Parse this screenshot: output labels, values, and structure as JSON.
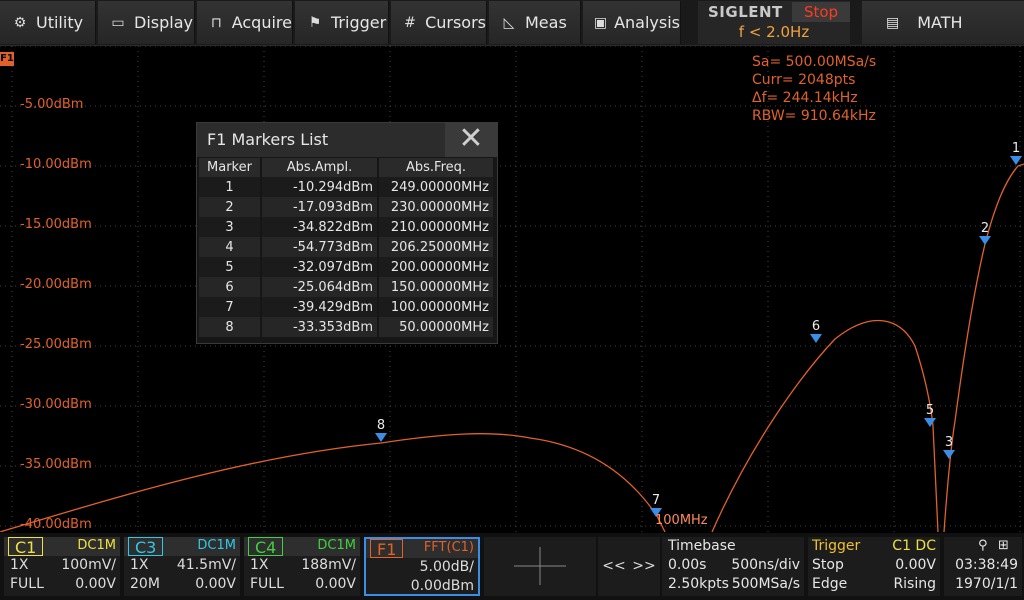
{
  "menu": {
    "utility": "Utility",
    "display": "Display",
    "acquire": "Acquire",
    "trigger": "Trigger",
    "cursors": "Cursors",
    "meas": "Meas",
    "analysis": "Analysis",
    "math": "MATH"
  },
  "brand": {
    "logo": "SIGLENT",
    "run_state": "Stop",
    "trigger_freq": "f < 2.0Hz"
  },
  "waveform": {
    "trace_tag": "F1",
    "y_labels": [
      "-5.00dBm",
      "-10.00dBm",
      "-15.00dBm",
      "-20.00dBm",
      "-25.00dBm",
      "-30.00dBm",
      "-35.00dBm",
      "-40.00dBm"
    ],
    "fft_info": {
      "sa": "Sa=  500.00MSa/s",
      "curr": "Curr= 2048pts",
      "df": "Δf=  244.14kHz",
      "rbw": "RBW=  910.64kHz"
    },
    "marker_freq_label": "100MHz",
    "marker_ids": [
      "1",
      "2",
      "3",
      "4",
      "5",
      "6",
      "7",
      "8"
    ],
    "trace_color": "#e0622a",
    "marker_color": "#3a8ee6"
  },
  "markers_list": {
    "title": "F1 Markers List",
    "columns": [
      "Marker",
      "Abs.Ampl.",
      "Abs.Freq."
    ],
    "rows": [
      [
        "1",
        "-10.294dBm",
        "249.00000MHz"
      ],
      [
        "2",
        "-17.093dBm",
        "230.00000MHz"
      ],
      [
        "3",
        "-34.822dBm",
        "210.00000MHz"
      ],
      [
        "4",
        "-54.773dBm",
        "206.25000MHz"
      ],
      [
        "5",
        "-32.097dBm",
        "200.00000MHz"
      ],
      [
        "6",
        "-25.064dBm",
        "150.00000MHz"
      ],
      [
        "7",
        "-39.429dBm",
        "100.00000MHz"
      ],
      [
        "8",
        "-33.353dBm",
        "50.00000MHz"
      ]
    ]
  },
  "channels": {
    "c1": {
      "name": "C1",
      "coupling": "DC1M",
      "probe": "1X",
      "scale": "100mV/",
      "bw": "FULL",
      "offset": "0.00V",
      "color": "#f0e040"
    },
    "c3": {
      "name": "C3",
      "coupling": "DC1M",
      "probe": "1X",
      "scale": "41.5mV/",
      "bw": "20M",
      "offset": "0.00V",
      "color": "#30c8e8"
    },
    "c4": {
      "name": "C4",
      "coupling": "DC1M",
      "probe": "1X",
      "scale": "188mV/",
      "bw": "FULL",
      "offset": "0.00V",
      "color": "#40d040"
    },
    "f1": {
      "name": "F1",
      "func": "FFT(C1)",
      "scale": "5.00dB/",
      "ref": "0.00dBm",
      "color": "#e0622a"
    }
  },
  "nav": {
    "prev": "<<",
    "next": ">>"
  },
  "timebase": {
    "title": "Timebase",
    "delay": "0.00s",
    "scale": "500ns/div",
    "points": "2.50kpts",
    "rate": "500MSa/s"
  },
  "trigger": {
    "title": "Trigger",
    "source": "C1 DC",
    "mode": "Stop",
    "level": "0.00V",
    "type": "Edge",
    "slope": "Rising"
  },
  "clock": {
    "time": "03:38:49",
    "date": "1970/1/1"
  }
}
